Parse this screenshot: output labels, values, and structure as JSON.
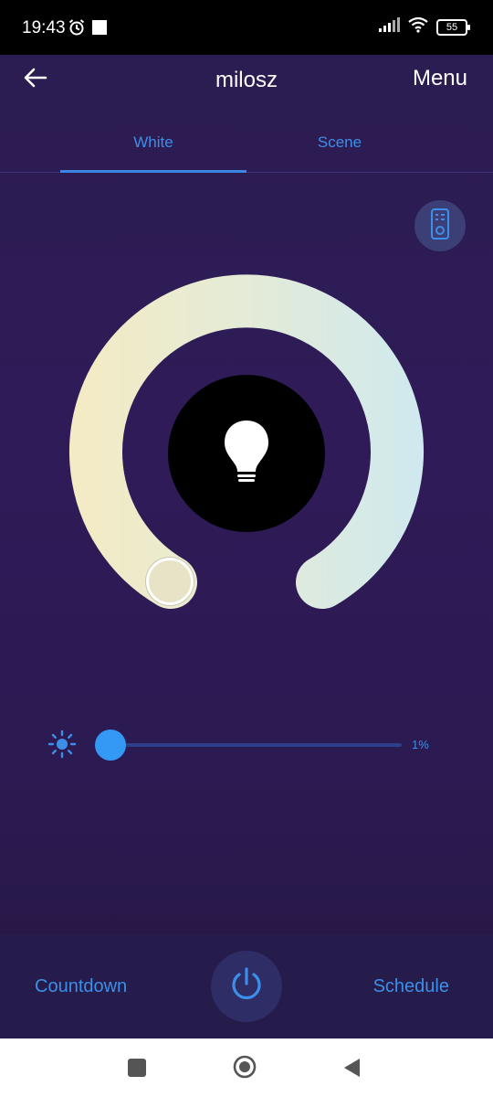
{
  "status_bar": {
    "time": "19:43",
    "battery": "55",
    "icons": [
      "alarm-icon",
      "square-notification-icon",
      "signal-icon",
      "wifi-icon",
      "battery-icon"
    ]
  },
  "header": {
    "title": "milosz",
    "menu_label": "Menu",
    "back_icon": "back-arrow-icon"
  },
  "tabs": [
    {
      "label": "White",
      "selected": true
    },
    {
      "label": "Scene",
      "selected": false
    }
  ],
  "remote_icon": "remote-control-icon",
  "color_temperature": {
    "value_fraction": 0.0,
    "warm_color": "#f4ecc6",
    "cool_color": "#cfe9ef"
  },
  "bulb": {
    "icon": "light-bulb-icon",
    "on": false
  },
  "brightness": {
    "icon": "sun-icon",
    "value": "1%",
    "fraction": 0.01
  },
  "bottom_bar": {
    "countdown_label": "Countdown",
    "schedule_label": "Schedule",
    "power_icon": "power-icon"
  },
  "colors": {
    "accent": "#3d8ee8",
    "background": "#2f1b58",
    "bottom_bar": "#261c4b"
  },
  "system_nav": {
    "icons": [
      "recent-apps-icon",
      "home-icon",
      "back-triangle-icon"
    ]
  }
}
